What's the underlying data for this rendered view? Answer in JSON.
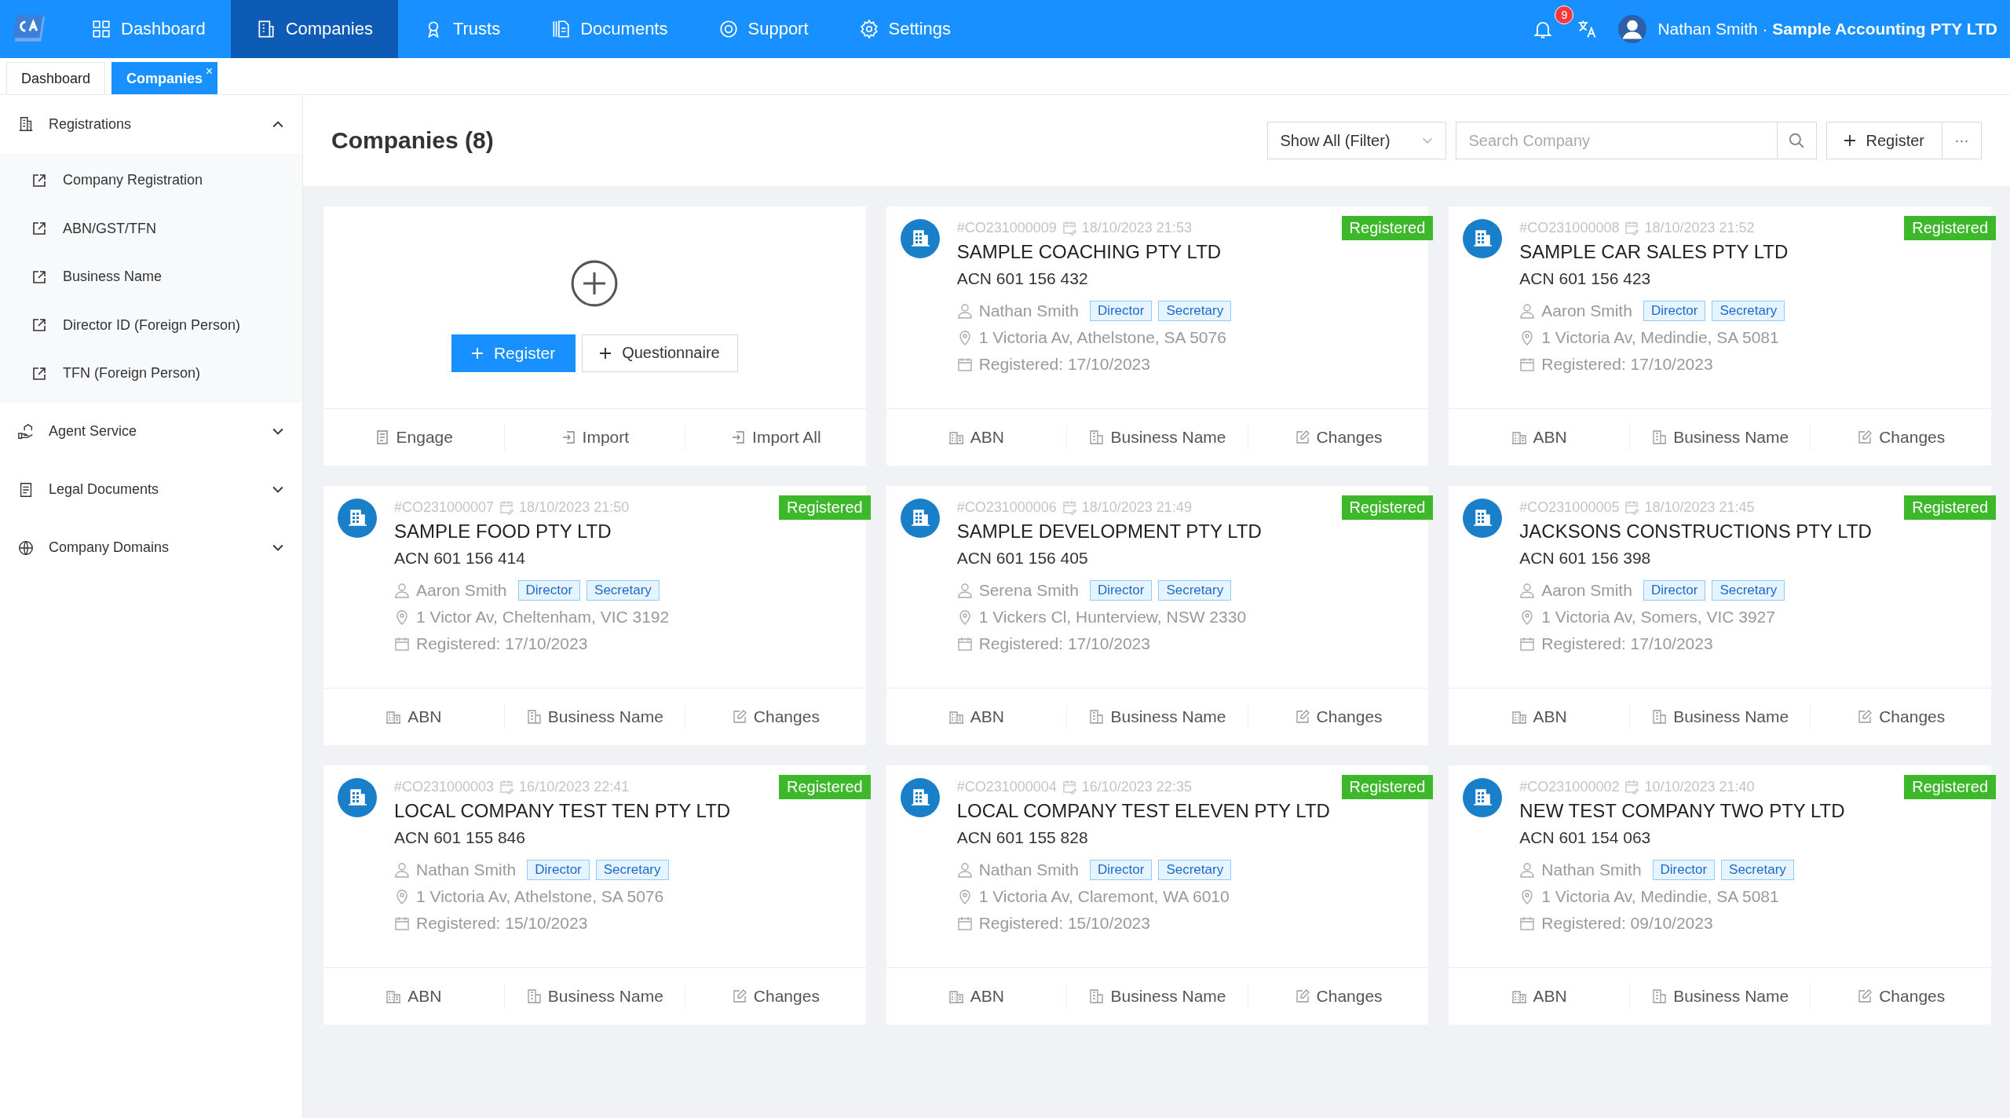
{
  "nav": {
    "items": [
      {
        "label": "Dashboard",
        "selected": false
      },
      {
        "label": "Companies",
        "selected": true
      },
      {
        "label": "Trusts",
        "selected": false
      },
      {
        "label": "Documents",
        "selected": false
      },
      {
        "label": "Support",
        "selected": false
      },
      {
        "label": "Settings",
        "selected": false
      }
    ],
    "notifications": "9",
    "user": "Nathan Smith · **Sample Accounting PTY LTD**"
  },
  "page_tabs": [
    {
      "label": "Dashboard",
      "selected": false
    },
    {
      "label": "Companies",
      "selected": true,
      "close": "×"
    }
  ],
  "sidebar": {
    "groups": [
      {
        "label": "Registrations",
        "expanded": true,
        "children": [
          {
            "label": "Company Registration"
          },
          {
            "label": "ABN/GST/TFN"
          },
          {
            "label": "Business Name"
          },
          {
            "label": "Director ID (Foreign Person)"
          },
          {
            "label": "TFN (Foreign Person)"
          }
        ]
      },
      {
        "label": "Agent Service",
        "expanded": false
      },
      {
        "label": "Legal Documents",
        "expanded": false
      },
      {
        "label": "Company Domains",
        "expanded": false
      }
    ]
  },
  "toolbar": {
    "title": "Companies (8)",
    "filter": "Show All (Filter)",
    "search": {
      "placeholder": "Search Company"
    },
    "register": "Register",
    "more": "···"
  },
  "add_card": {
    "register": "Register",
    "questionnaire": "Questionnaire",
    "actions": [
      "Engage",
      "Import",
      "Import All"
    ]
  },
  "companies": [
    {
      "id": "#CO231000009",
      "datetime": "18/10/2023 21:53",
      "name": "SAMPLE COACHING PTY LTD",
      "acn": "ACN 601 156 432",
      "person": "Nathan Smith",
      "roles": [
        "Director",
        "Secretary"
      ],
      "address": "1 Victoria Av, Athelstone, SA 5076",
      "registered": "Registered: 17/10/2023",
      "status": "Registered",
      "actions": [
        "ABN",
        "Business Name",
        "Changes"
      ]
    },
    {
      "id": "#CO231000008",
      "datetime": "18/10/2023 21:52",
      "name": "SAMPLE CAR SALES PTY LTD",
      "acn": "ACN 601 156 423",
      "person": "Aaron Smith",
      "roles": [
        "Director",
        "Secretary"
      ],
      "address": "1 Victoria Av, Medindie, SA 5081",
      "registered": "Registered: 17/10/2023",
      "status": "Registered",
      "actions": [
        "ABN",
        "Business Name",
        "Changes"
      ]
    },
    {
      "id": "#CO231000007",
      "datetime": "18/10/2023 21:50",
      "name": "SAMPLE FOOD PTY LTD",
      "acn": "ACN 601 156 414",
      "person": "Aaron Smith",
      "roles": [
        "Director",
        "Secretary"
      ],
      "address": "1 Victor Av, Cheltenham, VIC 3192",
      "registered": "Registered: 17/10/2023",
      "status": "Registered",
      "actions": [
        "ABN",
        "Business Name",
        "Changes"
      ]
    },
    {
      "id": "#CO231000006",
      "datetime": "18/10/2023 21:49",
      "name": "SAMPLE DEVELOPMENT PTY LTD",
      "acn": "ACN 601 156 405",
      "person": "Serena Smith",
      "roles": [
        "Director",
        "Secretary"
      ],
      "address": "1 Vickers Cl, Hunterview, NSW 2330",
      "registered": "Registered: 17/10/2023",
      "status": "Registered",
      "actions": [
        "ABN",
        "Business Name",
        "Changes"
      ]
    },
    {
      "id": "#CO231000005",
      "datetime": "18/10/2023 21:45",
      "name": "JACKSONS CONSTRUCTIONS PTY LTD",
      "acn": "ACN 601 156 398",
      "person": "Aaron Smith",
      "roles": [
        "Director",
        "Secretary"
      ],
      "address": "1 Victoria Av, Somers, VIC 3927",
      "registered": "Registered: 17/10/2023",
      "status": "Registered",
      "actions": [
        "ABN",
        "Business Name",
        "Changes"
      ]
    },
    {
      "id": "#CO231000003",
      "datetime": "16/10/2023 22:41",
      "name": "LOCAL COMPANY TEST TEN PTY LTD",
      "acn": "ACN 601 155 846",
      "person": "Nathan Smith",
      "roles": [
        "Director",
        "Secretary"
      ],
      "address": "1 Victoria Av, Athelstone, SA 5076",
      "registered": "Registered: 15/10/2023",
      "status": "Registered",
      "actions": [
        "ABN",
        "Business Name",
        "Changes"
      ]
    },
    {
      "id": "#CO231000004",
      "datetime": "16/10/2023 22:35",
      "name": "LOCAL COMPANY TEST ELEVEN PTY LTD",
      "acn": "ACN 601 155 828",
      "person": "Nathan Smith",
      "roles": [
        "Director",
        "Secretary"
      ],
      "address": "1 Victoria Av, Claremont, WA 6010",
      "registered": "Registered: 15/10/2023",
      "status": "Registered",
      "actions": [
        "ABN",
        "Business Name",
        "Changes"
      ]
    },
    {
      "id": "#CO231000002",
      "datetime": "10/10/2023 21:40",
      "name": "NEW TEST COMPANY TWO PTY LTD",
      "acn": "ACN 601 154 063",
      "person": "Nathan Smith",
      "roles": [
        "Director",
        "Secretary"
      ],
      "address": "1 Victoria Av, Medindie, SA 5081",
      "registered": "Registered: 09/10/2023",
      "status": "Registered",
      "actions": [
        "ABN",
        "Business Name",
        "Changes"
      ]
    }
  ]
}
